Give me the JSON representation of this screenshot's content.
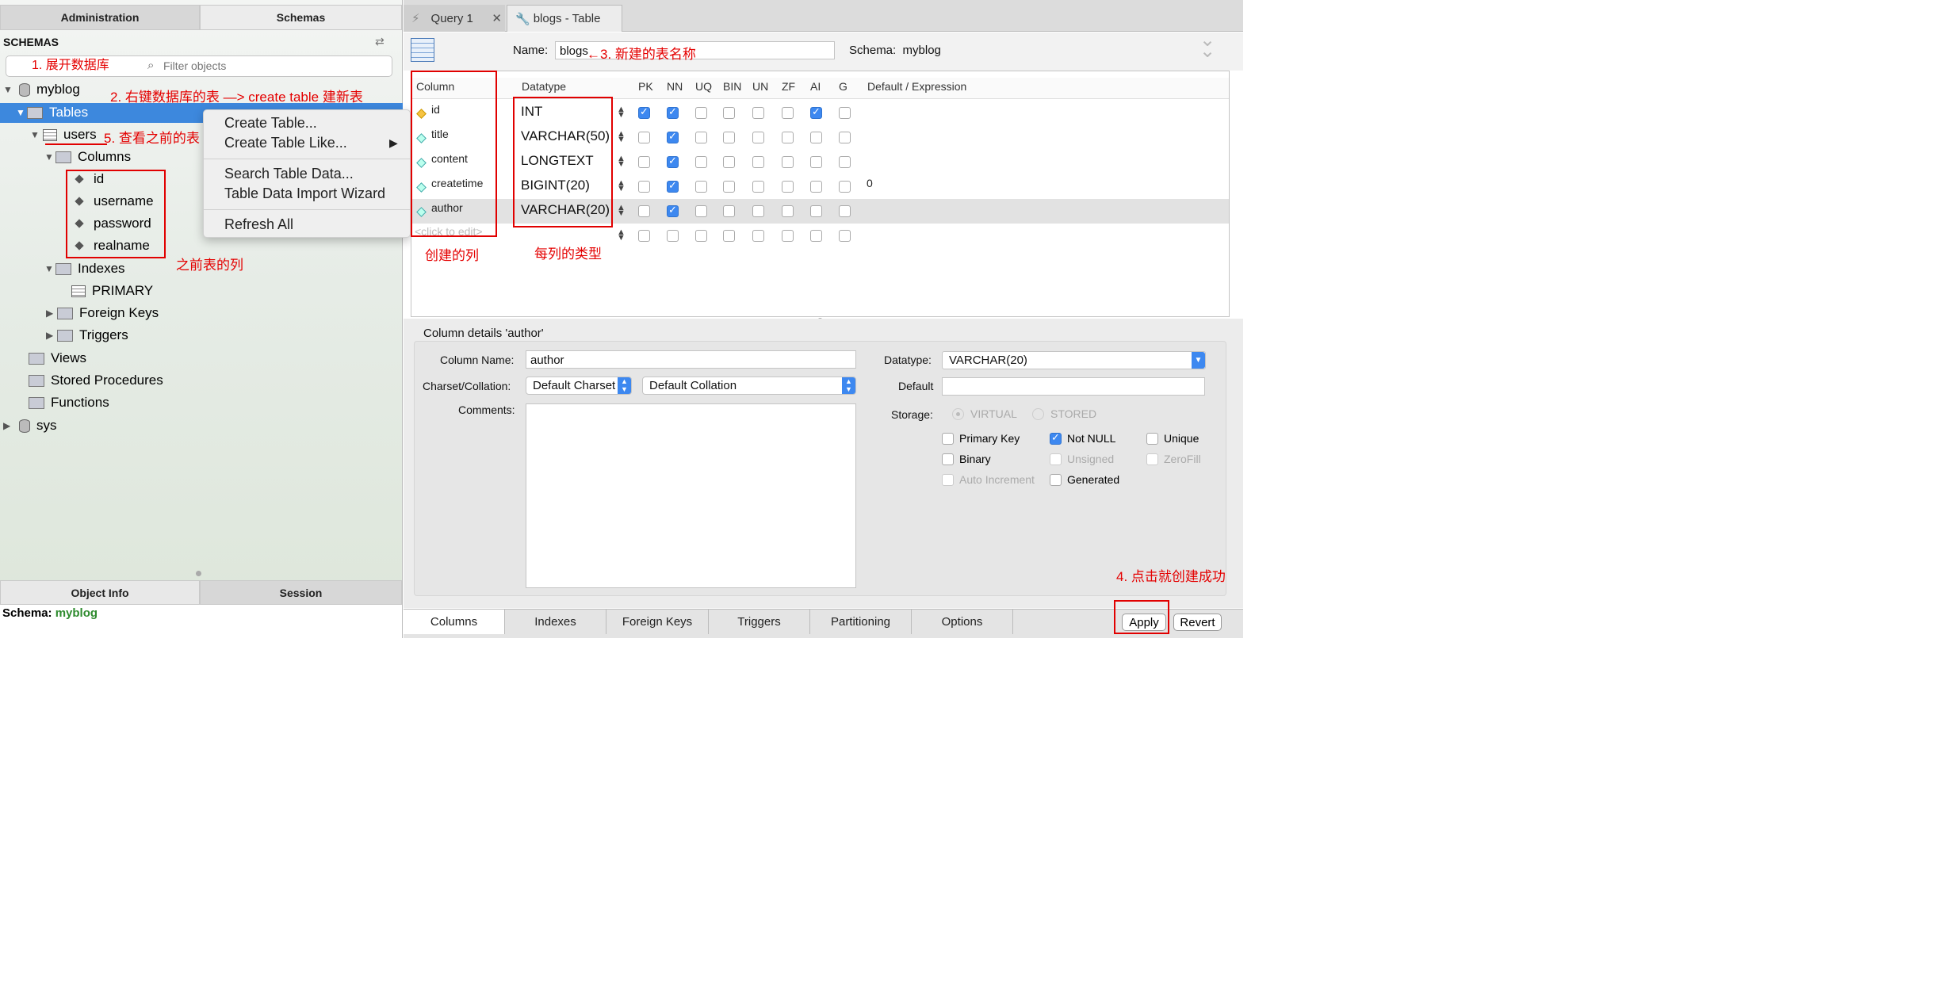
{
  "left": {
    "tabs": [
      "Administration",
      "Schemas"
    ],
    "header": "SCHEMAS",
    "filter_placeholder": "Filter objects",
    "tree": {
      "db": "myblog",
      "tables": "Tables",
      "users": "users",
      "columns": "Columns",
      "cols": [
        "id",
        "username",
        "password",
        "realname"
      ],
      "indexes": "Indexes",
      "primary": "PRIMARY",
      "fkeys": "Foreign Keys",
      "triggers": "Triggers",
      "views": "Views",
      "procs": "Stored Procedures",
      "funcs": "Functions",
      "sys": "sys"
    },
    "bottom_tabs": [
      "Object Info",
      "Session"
    ],
    "schema_label": "Schema:",
    "schema_value": "myblog"
  },
  "context_menu": [
    "Create Table...",
    "Create Table Like...",
    "Search Table Data...",
    "Table Data Import Wizard",
    "Refresh All"
  ],
  "annotations": {
    "a1": "1. 展开数据库",
    "a2": "2. 右键数据库的表 —> create  table 建新表",
    "a3": "3. 新建的表名称",
    "a4": "4. 点击就创建成功",
    "a5": "5. 查看之前的表",
    "prev_cols": "之前表的列",
    "created_cols": "创建的列",
    "col_types": "每列的类型"
  },
  "editor": {
    "tabs": [
      "Query 1",
      "blogs - Table"
    ],
    "name_label": "Name:",
    "name_value": "blogs",
    "schema_label": "Schema:",
    "schema_value": "myblog",
    "headers": [
      "Column",
      "Datatype",
      "PK",
      "NN",
      "UQ",
      "BIN",
      "UN",
      "ZF",
      "AI",
      "G",
      "Default / Expression"
    ],
    "rows": [
      {
        "name": "id",
        "type": "INT",
        "flags": [
          1,
          1,
          0,
          0,
          0,
          0,
          1,
          0
        ],
        "default": ""
      },
      {
        "name": "title",
        "type": "VARCHAR(50)",
        "flags": [
          0,
          1,
          0,
          0,
          0,
          0,
          0,
          0
        ],
        "default": ""
      },
      {
        "name": "content",
        "type": "LONGTEXT",
        "flags": [
          0,
          1,
          0,
          0,
          0,
          0,
          0,
          0
        ],
        "default": ""
      },
      {
        "name": "createtime",
        "type": "BIGINT(20)",
        "flags": [
          0,
          1,
          0,
          0,
          0,
          0,
          0,
          0
        ],
        "default": "0"
      },
      {
        "name": "author",
        "type": "VARCHAR(20)",
        "flags": [
          0,
          1,
          0,
          0,
          0,
          0,
          0,
          0
        ],
        "default": ""
      }
    ],
    "new_row": "<click to edit>"
  },
  "details": {
    "title": "Column details 'author'",
    "col_name_label": "Column Name:",
    "col_name": "author",
    "charset_label": "Charset/Collation:",
    "charset": "Default Charset",
    "collation": "Default Collation",
    "comments_label": "Comments:",
    "datatype_label": "Datatype:",
    "datatype": "VARCHAR(20)",
    "default_label": "Default",
    "storage_label": "Storage:",
    "virtual": "VIRTUAL",
    "stored": "STORED",
    "opts": [
      "Primary Key",
      "Not NULL",
      "Unique",
      "Binary",
      "Unsigned",
      "ZeroFill",
      "Auto Increment",
      "Generated"
    ]
  },
  "bottom_tabs": [
    "Columns",
    "Indexes",
    "Foreign Keys",
    "Triggers",
    "Partitioning",
    "Options"
  ],
  "buttons": {
    "apply": "Apply",
    "revert": "Revert"
  }
}
